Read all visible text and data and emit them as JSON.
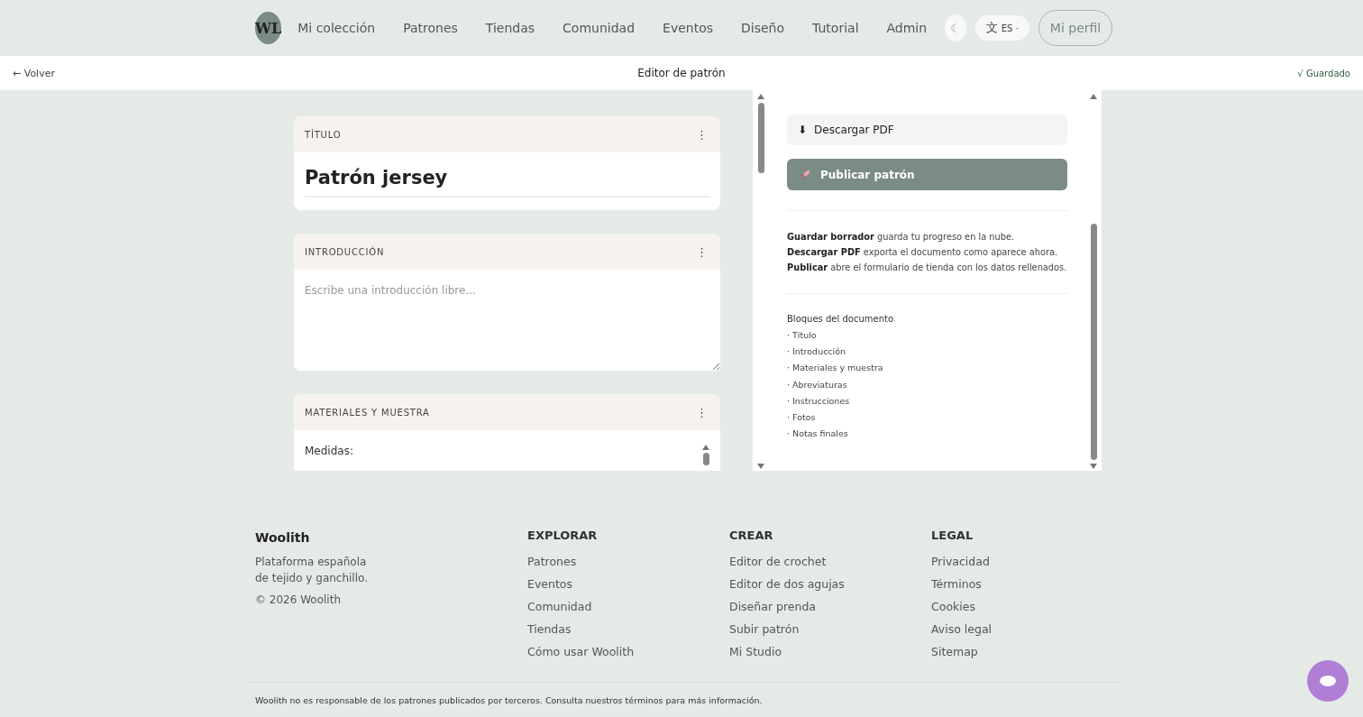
{
  "nav": {
    "logo": "WL",
    "items": [
      {
        "label": "Mi colección"
      },
      {
        "label": "Patrones"
      },
      {
        "label": "Tiendas"
      },
      {
        "label": "Comunidad"
      },
      {
        "label": "Eventos"
      },
      {
        "label": "Diseño"
      },
      {
        "label": "Tutorial"
      },
      {
        "label": "Admin"
      }
    ],
    "theme_toggle": "☾",
    "language": {
      "icon": "文",
      "code": "ES",
      "caret": "·"
    },
    "profile": "Mi perfil"
  },
  "subbar": {
    "back": "← Volver",
    "title": "Editor de patrón",
    "status": "√ Guardado"
  },
  "blocks": [
    {
      "kind": "title",
      "label": "TÍTULO",
      "menu": "⋮",
      "value": "Patrón jersey"
    },
    {
      "kind": "textarea",
      "label": "INTRODUCCIÓN",
      "menu": "⋮",
      "placeholder": "Escribe una introducción libre..."
    },
    {
      "kind": "scroll",
      "label": "MATERIALES Y MUESTRA",
      "menu": "⋮",
      "value": "Medidas:"
    }
  ],
  "side": {
    "download": {
      "icon": "⬇",
      "label": "Descargar PDF"
    },
    "publish": {
      "label": "Publicar patrón"
    },
    "help": [
      "**Guardar borrador** guarda tu progreso en la nube.",
      "**Descargar PDF** exporta el documento como aparece ahora.",
      "**Publicar** abre el formulario de tienda con los datos rellenados."
    ],
    "outline_title": "Bloques del documento",
    "outline": [
      "· Título",
      "· Introducción",
      "· Materiales y muestra",
      "· Abreviaturas",
      "· Instrucciones",
      "· Fotos",
      "· Notas finales"
    ]
  },
  "footer": {
    "brand": "Woolith",
    "tagline": "Plataforma española\nde tejido y ganchillo.",
    "copyright": "© 2026 Woolith",
    "columns": [
      {
        "title": "EXPLORAR",
        "links": [
          "Patrones",
          "Eventos",
          "Comunidad",
          "Tiendas",
          "Cómo usar Woolith"
        ]
      },
      {
        "title": "CREAR",
        "links": [
          "Editor de crochet",
          "Editor de dos agujas",
          "Diseñar prenda",
          "Subir patrón",
          "Mi Studio"
        ]
      },
      {
        "title": "LEGAL",
        "links": [
          "Privacidad",
          "Términos",
          "Cookies",
          "Aviso legal",
          "Sitemap"
        ]
      }
    ],
    "disclaimer": "Woolith no es responsable de los patrones publicados por terceros. Consulta nuestros términos para más información."
  }
}
